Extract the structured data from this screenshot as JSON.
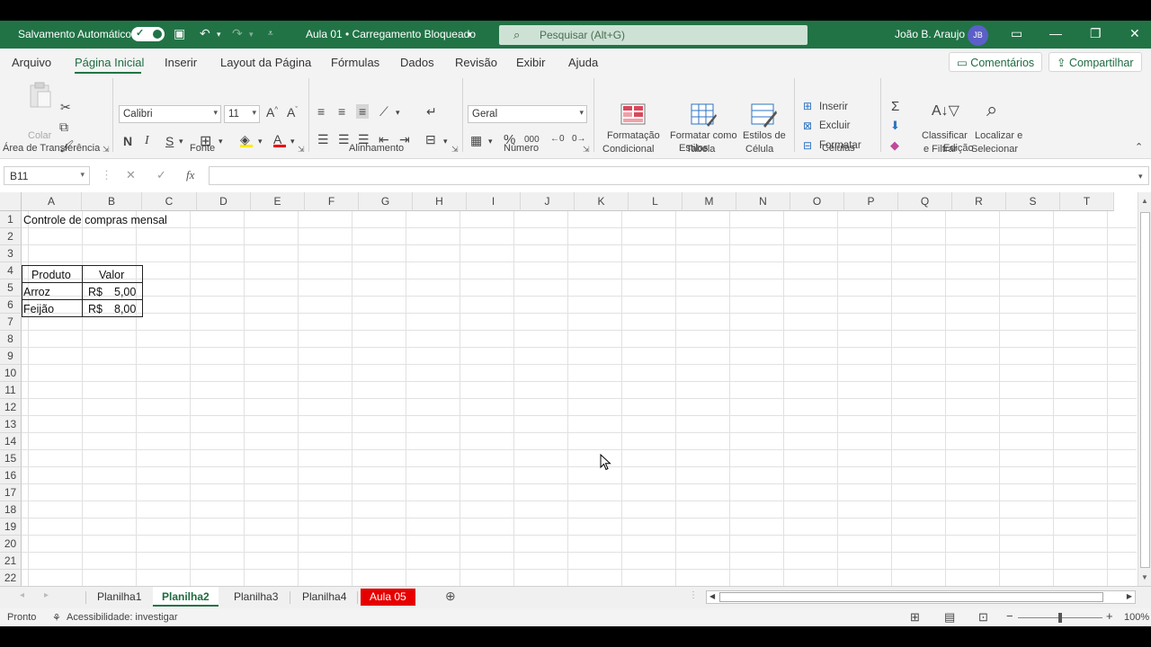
{
  "titlebar": {
    "autosave_label": "Salvamento Automático",
    "doc_title": "Aula 01 • Carregamento Bloqueado",
    "search_placeholder": "Pesquisar (Alt+G)",
    "user_name": "João B. Araujo",
    "user_initials": "JB"
  },
  "menu": {
    "items": [
      "Arquivo",
      "Página Inicial",
      "Inserir",
      "Layout da Página",
      "Fórmulas",
      "Dados",
      "Revisão",
      "Exibir",
      "Ajuda"
    ],
    "comments_label": "Comentários",
    "share_label": "Compartilhar"
  },
  "ribbon": {
    "clipboard": {
      "paste_label": "Colar",
      "group_label": "Área de Transferência"
    },
    "font": {
      "name": "Calibri",
      "size": "11",
      "bold": "N",
      "italic": "I",
      "underline": "S",
      "group_label": "Fonte"
    },
    "alignment": {
      "group_label": "Alinhamento"
    },
    "number": {
      "format": "Geral",
      "group_label": "Número"
    },
    "styles": {
      "cond_format_line1": "Formatação",
      "cond_format_line2": "Condicional",
      "table_format_line1": "Formatar como",
      "table_format_line2": "Tabela",
      "cell_styles_line1": "Estilos de",
      "cell_styles_line2": "Célula",
      "group_label": "Estilos"
    },
    "cells": {
      "insert": "Inserir",
      "delete": "Excluir",
      "format": "Formatar",
      "group_label": "Células"
    },
    "editing": {
      "sort_line1": "Classificar",
      "sort_line2": "e Filtrar",
      "find_line1": "Localizar e",
      "find_line2": "Selecionar",
      "group_label": "Edição"
    }
  },
  "formula_bar": {
    "name_box": "B11",
    "fx": "fx",
    "value": ""
  },
  "grid": {
    "columns": [
      "A",
      "B",
      "C",
      "D",
      "E",
      "F",
      "G",
      "H",
      "I",
      "J",
      "K",
      "L",
      "M",
      "N",
      "O",
      "P",
      "Q",
      "R",
      "S",
      "T"
    ],
    "rows": [
      "1",
      "2",
      "3",
      "4",
      "5",
      "6",
      "7",
      "8",
      "9",
      "10",
      "11",
      "12",
      "13",
      "14",
      "15",
      "16",
      "17",
      "18",
      "19",
      "20",
      "21",
      "22"
    ],
    "A1": "Controle de compras mensal",
    "table": {
      "header_produto": "Produto",
      "header_valor": "Valor",
      "row1_produto": "Arroz",
      "row1_currency": "R$",
      "row1_valor": "5,00",
      "row2_produto": "Feijão",
      "row2_currency": "R$",
      "row2_valor": "8,00"
    }
  },
  "sheets": [
    "Planilha1",
    "Planilha2",
    "Planilha3",
    "Planilha4",
    "Aula 05"
  ],
  "active_sheet": "Planilha2",
  "status": {
    "ready": "Pronto",
    "accessibility": "Acessibilidade: investigar",
    "zoom": "100%"
  },
  "colors": {
    "excel_green": "#217346",
    "tab_red": "#e60000",
    "avatar": "#5b5fc7"
  }
}
